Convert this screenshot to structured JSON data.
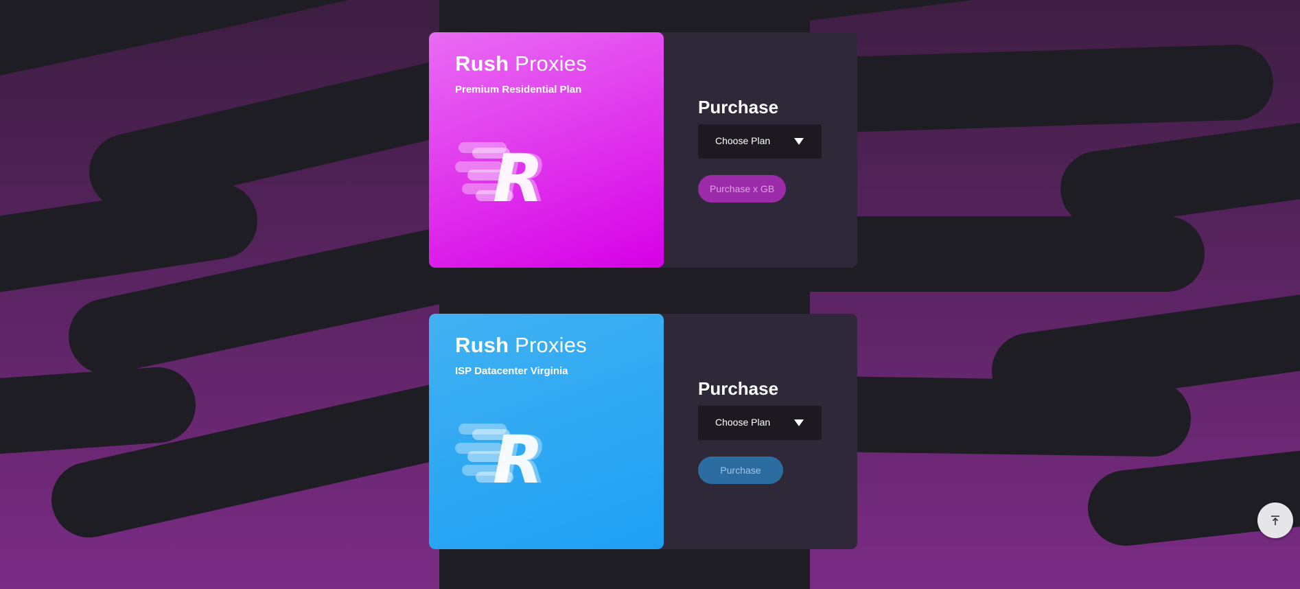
{
  "colors": {
    "background": "#1f1d24",
    "background_stripes": "#722b7a",
    "residential_accent": "#d600e6",
    "datacenter_accent": "#1ea0f4",
    "purchase_panel": "#2f2838"
  },
  "cards": [
    {
      "brand_bold": "Rush",
      "brand_light": "Proxies",
      "plan_name": "Premium Residential Plan",
      "logo_letter": "R",
      "purchase_heading": "Purchase",
      "select_value": "Choose Plan",
      "button_label": "Purchase x GB"
    },
    {
      "brand_bold": "Rush",
      "brand_light": "Proxies",
      "plan_name": "ISP Datacenter Virginia",
      "logo_letter": "R",
      "purchase_heading": "Purchase",
      "select_value": "Choose Plan",
      "button_label": "Purchase"
    }
  ],
  "scroll_top": {
    "icon": "arrow-up-to-line-icon"
  }
}
